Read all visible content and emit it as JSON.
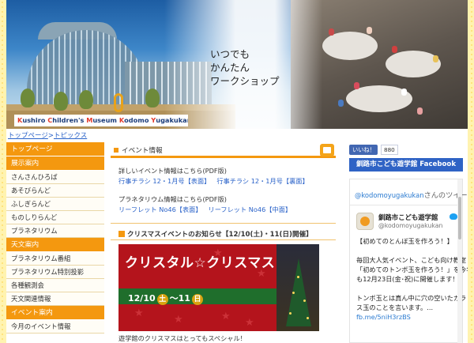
{
  "header": {
    "tagline": [
      "いつでも",
      "かんたん",
      "ワークショップ"
    ],
    "logo_initials": [
      "K",
      "C",
      "M",
      "K",
      "Y"
    ],
    "logo_rest": [
      "ushiro ",
      "hildren's ",
      "useum ",
      "odomo ",
      "ugakukan"
    ]
  },
  "breadcrumb": {
    "home": "トップページ",
    "separator": ">",
    "current": "トピックス"
  },
  "sidebar": {
    "sections": [
      {
        "heading": "トップページ",
        "items": []
      },
      {
        "heading": "展示案内",
        "items": [
          "さんさんひろば",
          "あそびらんど",
          "ふしぎらんど",
          "ものしりらんど",
          "プラネタリウム"
        ]
      },
      {
        "heading": "天文案内",
        "items": [
          "プラネタリウム番組",
          "プラネタリウム特別投影",
          "各種観測会",
          "天文関連情報"
        ]
      },
      {
        "heading": "イベント案内",
        "items": [
          "今月のイベント情報"
        ]
      }
    ]
  },
  "main": {
    "section_title": "イベント情報",
    "detail_text_1": "詳しいイベント情報はこちら(PDF版)",
    "flyer_links": [
      "行事チラシ 12・1月号【表面】",
      "行事チラシ 12・1月号【裏面】"
    ],
    "detail_text_2": "プラネタリウム情報はこちら(PDF版)",
    "leaflet_links": [
      "リーフレット No46【表面】",
      "リーフレット No46【中面】"
    ],
    "news_title": "クリスマスイベントのお知らせ【12/10(土)・11(日)開催】",
    "banner": {
      "title": "クリスタル☆クリスマス",
      "date_start": "12/10",
      "day_start": "土",
      "tilde": "～",
      "date_end": "11",
      "day_end": "日"
    },
    "caption": "遊学館のクリスマスはとってもスペシャル！"
  },
  "right": {
    "like_label": "いいね！",
    "like_count": "880",
    "fb_banner": "釧路市こども遊学館 Facebook",
    "twitter": {
      "handle_prefix": "@kodomoyugakukan",
      "handle_suffix": "さんのツイート",
      "name": "釧路市こども遊学館",
      "handle": "@kodomoyugakukan",
      "tweet_lines": [
        "【初めてのとんぼ玉を作ろう！】",
        "",
        "毎回大人気イベント、こども向け教室",
        "「初めてのトンボ玉を作ろう！」を今年",
        "も12月23日(金･祝)に開催します！",
        "",
        "トンボ玉とは真ん中に穴の空いたガラ",
        "ス玉のことを言います。..."
      ],
      "tweet_link": "fb.me/5niH3rzBS"
    }
  }
}
